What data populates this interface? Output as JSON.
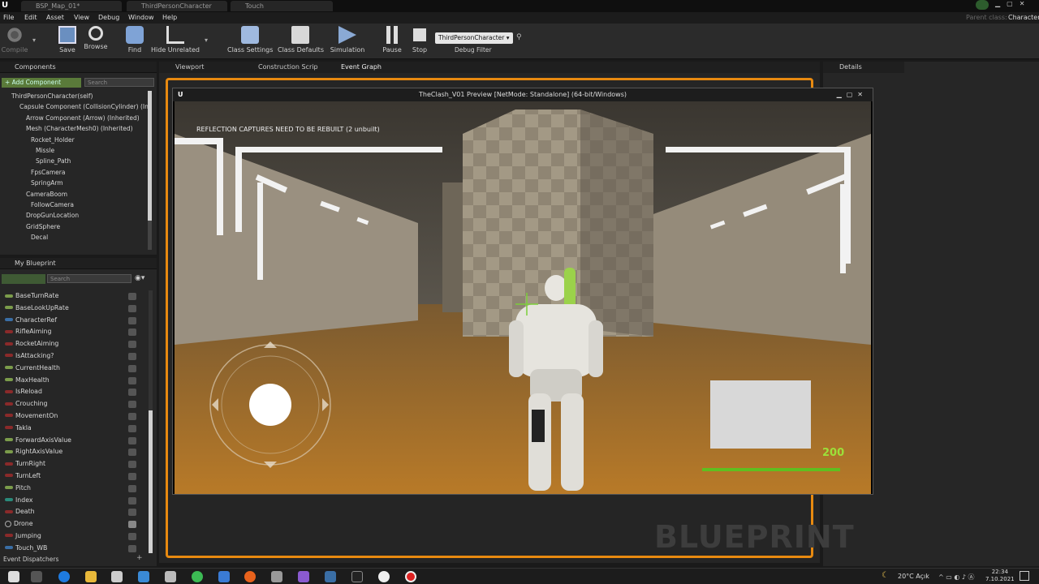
{
  "tabs": {
    "map": "BSP_Map_01*",
    "character": "ThirdPersonCharacter",
    "touch": "Touch"
  },
  "parent_class": {
    "label": "Parent class:",
    "value": "Character"
  },
  "menu": [
    "File",
    "Edit",
    "Asset",
    "View",
    "Debug",
    "Window",
    "Help"
  ],
  "toolbar": {
    "compile": "Compile",
    "save": "Save",
    "browse": "Browse",
    "find": "Find",
    "hide_unrelated": "Hide Unrelated",
    "class_settings": "Class Settings",
    "class_defaults": "Class Defaults",
    "simulation": "Simulation",
    "pause": "Pause",
    "stop": "Stop",
    "debug_select": "ThirdPersonCharacter",
    "debug_filter": "Debug Filter"
  },
  "components": {
    "title": "Components",
    "add_button": "+ Add Component",
    "search_placeholder": "Search",
    "items": [
      {
        "label": "ThirdPersonCharacter(self)",
        "indent": 0
      },
      {
        "label": "Capsule Component (CollisionCylinder) (In",
        "indent": 1
      },
      {
        "label": "Arrow Component (Arrow) (Inherited)",
        "indent": 2
      },
      {
        "label": "Mesh (CharacterMesh0) (Inherited)",
        "indent": 2
      },
      {
        "label": "Rocket_Holder",
        "indent": 3
      },
      {
        "label": "Missle",
        "indent": 4
      },
      {
        "label": "Spline_Path",
        "indent": 4
      },
      {
        "label": "FpsCamera",
        "indent": 3
      },
      {
        "label": "SpringArm",
        "indent": 3
      },
      {
        "label": "CameraBoom",
        "indent": 2
      },
      {
        "label": "FollowCamera",
        "indent": 3
      },
      {
        "label": "DropGunLocation",
        "indent": 2
      },
      {
        "label": "GridSphere",
        "indent": 2
      },
      {
        "label": "Decal",
        "indent": 3
      }
    ]
  },
  "my_blueprint": {
    "title": "My Blueprint",
    "search_placeholder": "Search",
    "variables": [
      "BaseTurnRate",
      "BaseLookUpRate",
      "CharacterRef",
      "RifleAiming",
      "RocketAiming",
      "IsAttacking?",
      "CurrentHealth",
      "MaxHealth",
      "IsReload",
      "Crouching",
      "MovementOn",
      "Takla",
      "ForwardAxisValue",
      "RightAxisValue",
      "TurnRight",
      "TurnLeft",
      "Pitch",
      "Index",
      "Death",
      "Drone",
      "Jumping",
      "Touch_WB"
    ],
    "event_dispatchers": "Event Dispatchers"
  },
  "editor_tabs": {
    "viewport": "Viewport",
    "construction": "Construction Scrip",
    "event_graph": "Event Graph",
    "details": "Details"
  },
  "graph": {
    "watermark": "BLUEPRINT"
  },
  "game_window": {
    "title": "TheClash_V01 Preview [NetMode: Standalone]  (64-bit/Windows)",
    "warning": "REFLECTION CAPTURES NEED TO BE REBUILT (2 unbuilt)",
    "health_value": "200",
    "health_fraction": 1.0
  },
  "taskbar": {
    "weather": "20°C  Açık",
    "time": "22:34",
    "date": "7.10.2021"
  }
}
